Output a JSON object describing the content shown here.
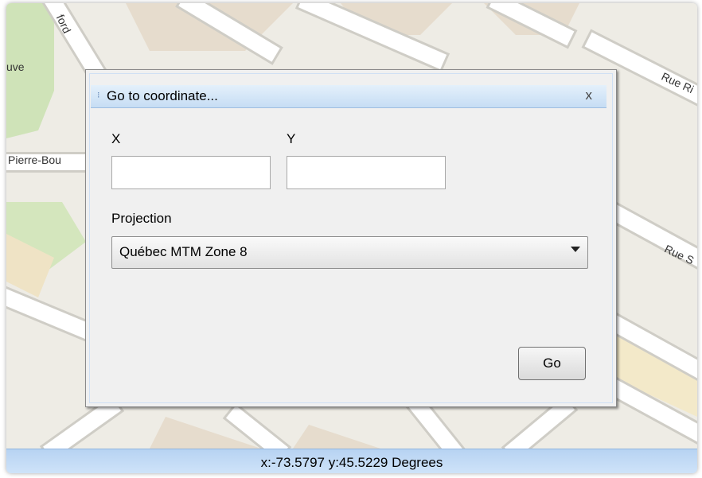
{
  "map": {
    "street_labels": [
      "ford",
      "uve",
      "Pierre-Bou",
      "Rue Ri",
      "Rue S"
    ]
  },
  "dialog": {
    "title": "Go to coordinate...",
    "close_label": "x",
    "x_label": "X",
    "y_label": "Y",
    "x_value": "",
    "y_value": "",
    "projection_label": "Projection",
    "projection_selected": "Québec MTM Zone 8",
    "go_label": "Go"
  },
  "status": {
    "coordinates_text": "x:-73.5797  y:45.5229 Degrees"
  },
  "colors": {
    "map_background": "#eeece5",
    "road": "#ffffff",
    "park": "#cfe3b8",
    "building": "#e4d8c9",
    "titlebar": "#c6ddf4",
    "statusbar": "#b7d3f2"
  }
}
